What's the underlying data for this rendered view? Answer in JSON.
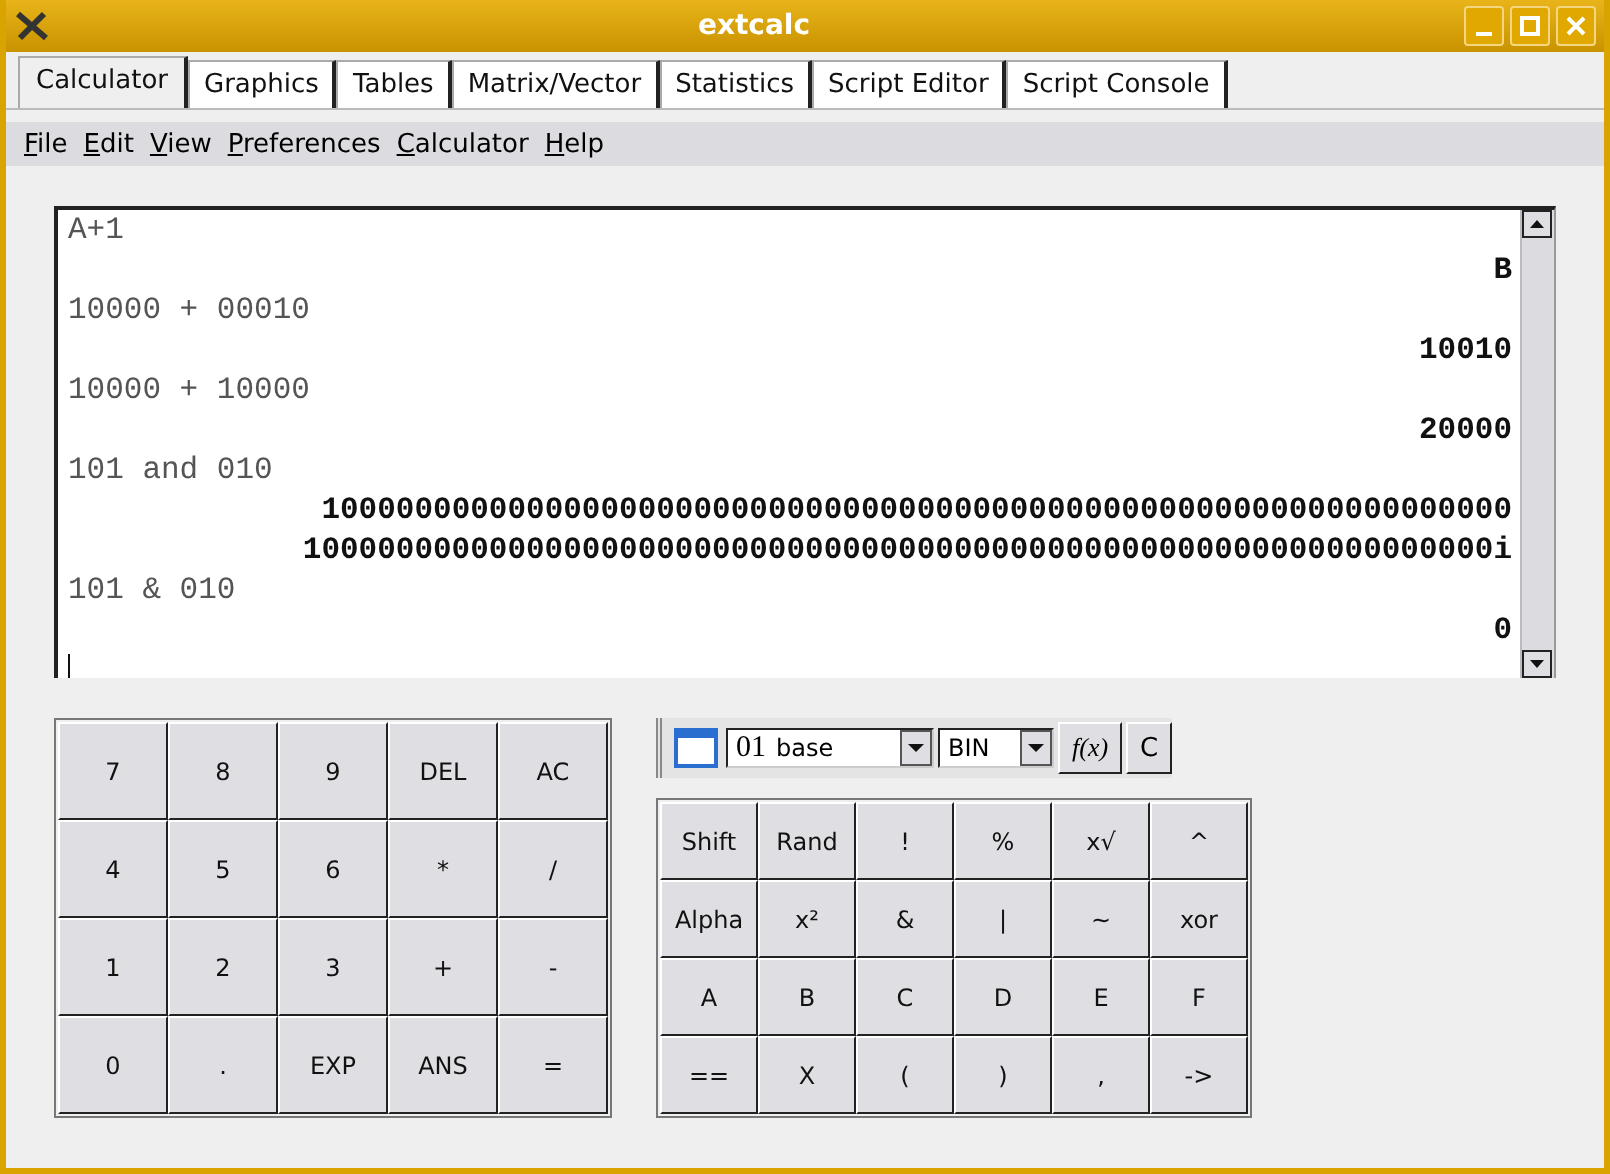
{
  "window": {
    "title": "extcalc"
  },
  "tabs": [
    {
      "label": "Calculator",
      "selected": true
    },
    {
      "label": "Graphics",
      "selected": false
    },
    {
      "label": "Tables",
      "selected": false
    },
    {
      "label": "Matrix/Vector",
      "selected": false
    },
    {
      "label": "Statistics",
      "selected": false
    },
    {
      "label": "Script Editor",
      "selected": false
    },
    {
      "label": "Script Console",
      "selected": false
    }
  ],
  "menu": [
    "File",
    "Edit",
    "View",
    "Preferences",
    "Calculator",
    "Help"
  ],
  "display": [
    {
      "kind": "expr",
      "text": "A+1"
    },
    {
      "kind": "result",
      "text": "B"
    },
    {
      "kind": "expr",
      "text": "10000 + 00010"
    },
    {
      "kind": "result",
      "text": "10010"
    },
    {
      "kind": "expr",
      "text": "10000 + 10000"
    },
    {
      "kind": "result",
      "text": "20000"
    },
    {
      "kind": "expr",
      "text": "101 and 010"
    },
    {
      "kind": "result",
      "text": "1000000000000000000000000000000000000000000000000000000000000000"
    },
    {
      "kind": "result",
      "text": "1000000000000000000000000000000000000000000000000000000000000000i"
    },
    {
      "kind": "expr",
      "text": "101 & 010"
    },
    {
      "kind": "result",
      "text": "0"
    }
  ],
  "keypad": [
    [
      "7",
      "8",
      "9",
      "DEL",
      "AC"
    ],
    [
      "4",
      "5",
      "6",
      "*",
      "/"
    ],
    [
      "1",
      "2",
      "3",
      "+",
      "-"
    ],
    [
      "0",
      ".",
      "EXP",
      "ANS",
      "="
    ]
  ],
  "toolbar": {
    "base_prefix": "01",
    "base_label": "base",
    "mode": "BIN",
    "function_button": "f(x)",
    "clear_button": "C"
  },
  "function_keys": [
    [
      "Shift",
      "Rand",
      "!",
      "%",
      "x√",
      "^"
    ],
    [
      "Alpha",
      "x²",
      "&",
      "|",
      "~",
      "xor"
    ],
    [
      "A",
      "B",
      "C",
      "D",
      "E",
      "F"
    ],
    [
      "==",
      "X",
      "(",
      ")",
      ",",
      "->"
    ]
  ]
}
